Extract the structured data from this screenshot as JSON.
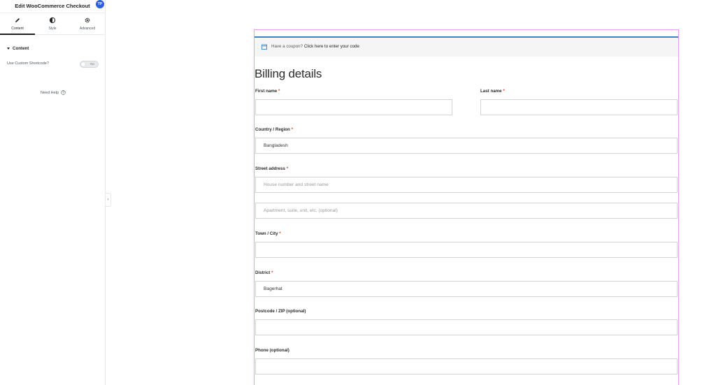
{
  "panel": {
    "title": "Edit WooCommerce Checkout",
    "badge": "TP",
    "tabs": [
      {
        "label": "Content",
        "icon": "pencil-icon",
        "active": true
      },
      {
        "label": "Style",
        "icon": "half-circle-icon",
        "active": false
      },
      {
        "label": "Advanced",
        "icon": "gear-icon",
        "active": false
      }
    ],
    "section_title": "Content",
    "shortcode_label": "Use Custom Shortcode?",
    "shortcode_toggle": "No",
    "need_help": "Need Help"
  },
  "checkout": {
    "coupon_prefix": "Have a coupon?",
    "coupon_link": "Click here to enter your code",
    "billing_title": "Billing details",
    "fields": {
      "first_name": {
        "label": "First name",
        "required": "*",
        "value": ""
      },
      "last_name": {
        "label": "Last name",
        "required": "*",
        "value": ""
      },
      "country": {
        "label": "Country / Region",
        "required": "*",
        "value": "Bangladesh"
      },
      "street": {
        "label": "Street address",
        "required": "*",
        "placeholder": "House number and street name",
        "placeholder2": "Apartment, suite, unit, etc. (optional)"
      },
      "city": {
        "label": "Town / City",
        "required": "*",
        "value": ""
      },
      "district": {
        "label": "District",
        "required": "*",
        "value": "Bagerhat"
      },
      "postcode": {
        "label": "Postcode / ZIP (optional)",
        "value": ""
      },
      "phone": {
        "label": "Phone (optional)",
        "value": ""
      }
    }
  },
  "colors": {
    "accent_blue": "#3a83c8",
    "required_red": "#e2401c",
    "frame_pink": "#e89cf0",
    "badge_blue": "#2d5fd6"
  }
}
